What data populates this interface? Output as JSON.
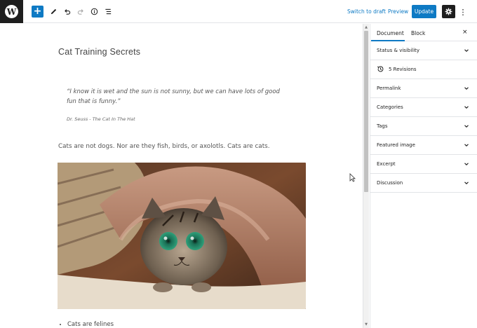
{
  "toolbar": {
    "add_label": "+",
    "switch_to_draft": "Switch to draft",
    "preview": "Preview",
    "update": "Update"
  },
  "post": {
    "title": "Cat Training Secrets",
    "quote": "“I know it is wet and the sun is not sunny, but we can have lots of good fun that is funny.”",
    "citation": "Dr. Seuss - The Cat In The Hat",
    "paragraph": "Cats are not dogs. Nor are they fish, birds, or axolotls. Cats are cats.",
    "list_items": [
      "Cats are felines"
    ]
  },
  "sidebar": {
    "tabs": [
      "Document",
      "Block"
    ],
    "close": "×",
    "panels": [
      {
        "label": "Status & visibility"
      },
      {
        "label": "5 Revisions"
      },
      {
        "label": "Permalink"
      },
      {
        "label": "Categories"
      },
      {
        "label": "Tags"
      },
      {
        "label": "Featured image"
      },
      {
        "label": "Excerpt"
      },
      {
        "label": "Discussion"
      }
    ]
  },
  "colors": {
    "accent": "#0e7ac4",
    "dark": "#1e1e1e"
  }
}
